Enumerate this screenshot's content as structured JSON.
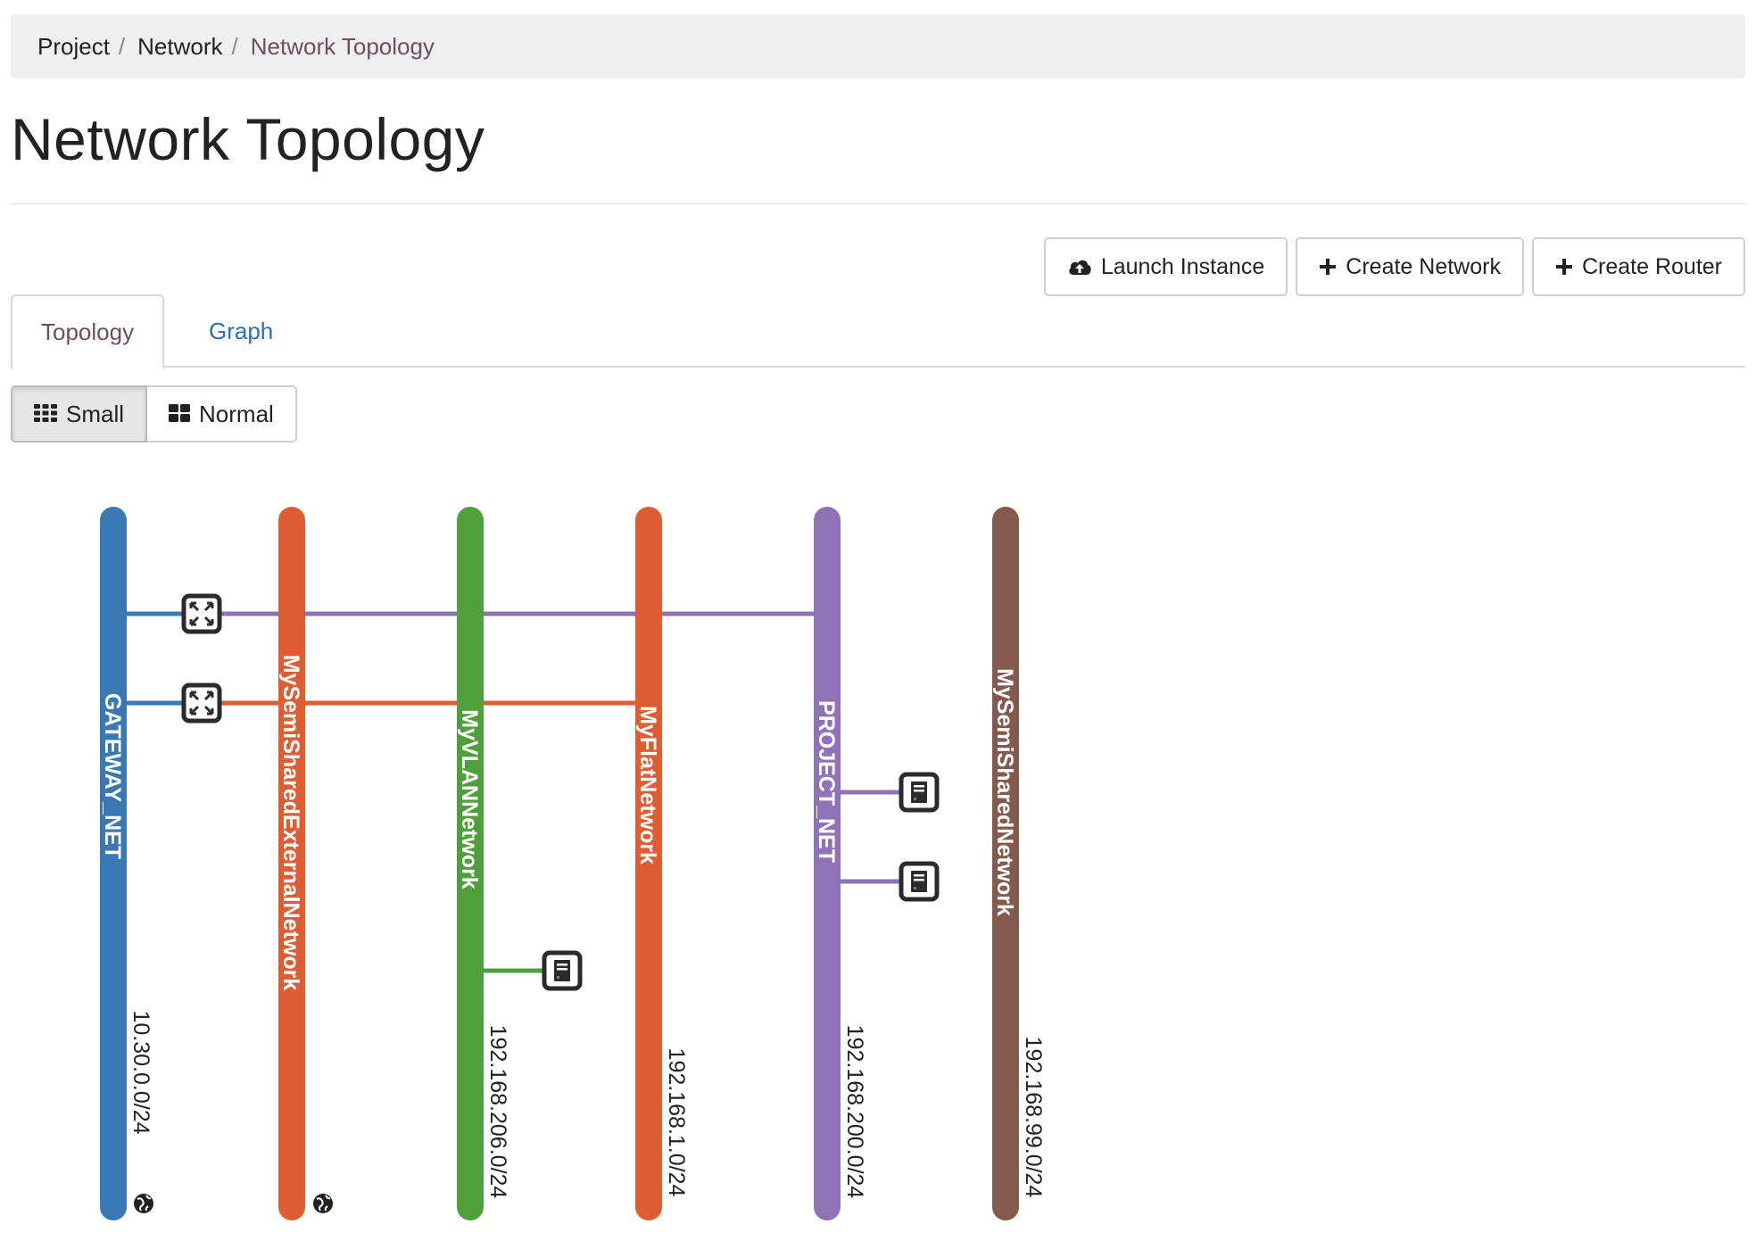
{
  "breadcrumb": [
    {
      "label": "Project",
      "sep": "/"
    },
    {
      "label": "Network",
      "sep": "/"
    },
    {
      "label": "Network Topology",
      "sep": ""
    }
  ],
  "page_title": "Network Topology",
  "actions": {
    "launch_instance": "Launch Instance",
    "create_network": "Create Network",
    "create_router": "Create Router"
  },
  "tabs": [
    {
      "label": "Topology",
      "active": true
    },
    {
      "label": "Graph",
      "active": false
    }
  ],
  "view_size": {
    "small": "Small",
    "normal": "Normal",
    "selected": "Small"
  },
  "networks": [
    {
      "name": "GATEWAY_NET",
      "cidr": "10.30.0.0/24",
      "color": "#3a78b3",
      "external": true
    },
    {
      "name": "MySemiSharedExternalNetwork",
      "cidr": "",
      "color": "#de5d33",
      "external": true
    },
    {
      "name": "MyVLANNetwork",
      "cidr": "192.168.206.0/24",
      "color": "#4fa03d",
      "external": false
    },
    {
      "name": "MyFlatNetwork",
      "cidr": "192.168.1.0/24",
      "color": "#de5d33",
      "external": false
    },
    {
      "name": "PROJECT_NET",
      "cidr": "192.168.200.0/24",
      "color": "#8f73b6",
      "external": false
    },
    {
      "name": "MySemiSharedNetwork",
      "cidr": "192.168.99.0/24",
      "color": "#845a4f",
      "external": false
    }
  ],
  "routers": [
    {
      "icon": "router-icon",
      "from_network": 0,
      "to_network": 4,
      "color": "#8f73b6"
    },
    {
      "icon": "router-icon",
      "from_network": 0,
      "to_network": 3,
      "color": "#de5d33"
    }
  ],
  "instances": [
    {
      "icon": "instance-icon",
      "network": 4
    },
    {
      "icon": "instance-icon",
      "network": 4
    },
    {
      "icon": "instance-icon",
      "network": 2
    }
  ],
  "colors": {
    "dark": "#2b2b2b",
    "link": "#2a6fb8",
    "active_crumb": "#6b4f63"
  }
}
